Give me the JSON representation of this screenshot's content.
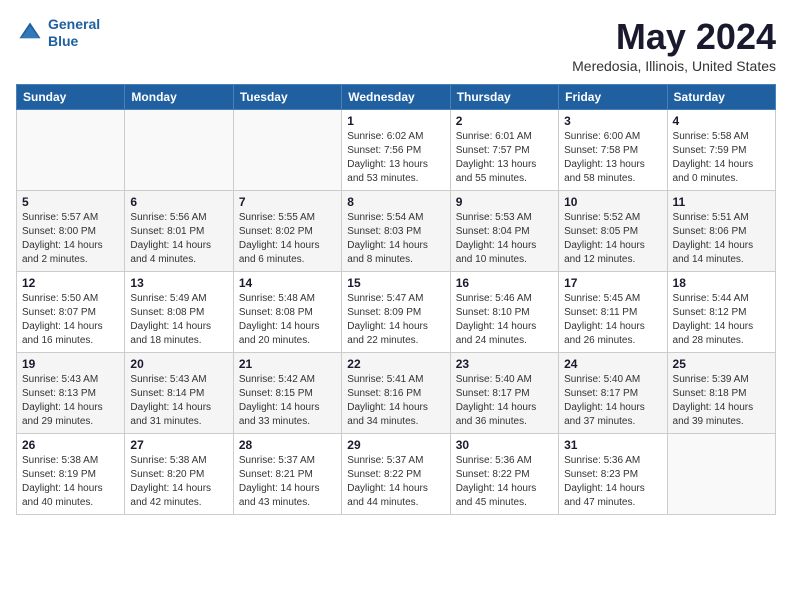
{
  "app": {
    "logo_line1": "General",
    "logo_line2": "Blue"
  },
  "title": "May 2024",
  "subtitle": "Meredosia, Illinois, United States",
  "calendar": {
    "headers": [
      "Sunday",
      "Monday",
      "Tuesday",
      "Wednesday",
      "Thursday",
      "Friday",
      "Saturday"
    ],
    "weeks": [
      [
        {
          "day": "",
          "details": ""
        },
        {
          "day": "",
          "details": ""
        },
        {
          "day": "",
          "details": ""
        },
        {
          "day": "1",
          "details": "Sunrise: 6:02 AM\nSunset: 7:56 PM\nDaylight: 13 hours\nand 53 minutes."
        },
        {
          "day": "2",
          "details": "Sunrise: 6:01 AM\nSunset: 7:57 PM\nDaylight: 13 hours\nand 55 minutes."
        },
        {
          "day": "3",
          "details": "Sunrise: 6:00 AM\nSunset: 7:58 PM\nDaylight: 13 hours\nand 58 minutes."
        },
        {
          "day": "4",
          "details": "Sunrise: 5:58 AM\nSunset: 7:59 PM\nDaylight: 14 hours\nand 0 minutes."
        }
      ],
      [
        {
          "day": "5",
          "details": "Sunrise: 5:57 AM\nSunset: 8:00 PM\nDaylight: 14 hours\nand 2 minutes."
        },
        {
          "day": "6",
          "details": "Sunrise: 5:56 AM\nSunset: 8:01 PM\nDaylight: 14 hours\nand 4 minutes."
        },
        {
          "day": "7",
          "details": "Sunrise: 5:55 AM\nSunset: 8:02 PM\nDaylight: 14 hours\nand 6 minutes."
        },
        {
          "day": "8",
          "details": "Sunrise: 5:54 AM\nSunset: 8:03 PM\nDaylight: 14 hours\nand 8 minutes."
        },
        {
          "day": "9",
          "details": "Sunrise: 5:53 AM\nSunset: 8:04 PM\nDaylight: 14 hours\nand 10 minutes."
        },
        {
          "day": "10",
          "details": "Sunrise: 5:52 AM\nSunset: 8:05 PM\nDaylight: 14 hours\nand 12 minutes."
        },
        {
          "day": "11",
          "details": "Sunrise: 5:51 AM\nSunset: 8:06 PM\nDaylight: 14 hours\nand 14 minutes."
        }
      ],
      [
        {
          "day": "12",
          "details": "Sunrise: 5:50 AM\nSunset: 8:07 PM\nDaylight: 14 hours\nand 16 minutes."
        },
        {
          "day": "13",
          "details": "Sunrise: 5:49 AM\nSunset: 8:08 PM\nDaylight: 14 hours\nand 18 minutes."
        },
        {
          "day": "14",
          "details": "Sunrise: 5:48 AM\nSunset: 8:08 PM\nDaylight: 14 hours\nand 20 minutes."
        },
        {
          "day": "15",
          "details": "Sunrise: 5:47 AM\nSunset: 8:09 PM\nDaylight: 14 hours\nand 22 minutes."
        },
        {
          "day": "16",
          "details": "Sunrise: 5:46 AM\nSunset: 8:10 PM\nDaylight: 14 hours\nand 24 minutes."
        },
        {
          "day": "17",
          "details": "Sunrise: 5:45 AM\nSunset: 8:11 PM\nDaylight: 14 hours\nand 26 minutes."
        },
        {
          "day": "18",
          "details": "Sunrise: 5:44 AM\nSunset: 8:12 PM\nDaylight: 14 hours\nand 28 minutes."
        }
      ],
      [
        {
          "day": "19",
          "details": "Sunrise: 5:43 AM\nSunset: 8:13 PM\nDaylight: 14 hours\nand 29 minutes."
        },
        {
          "day": "20",
          "details": "Sunrise: 5:43 AM\nSunset: 8:14 PM\nDaylight: 14 hours\nand 31 minutes."
        },
        {
          "day": "21",
          "details": "Sunrise: 5:42 AM\nSunset: 8:15 PM\nDaylight: 14 hours\nand 33 minutes."
        },
        {
          "day": "22",
          "details": "Sunrise: 5:41 AM\nSunset: 8:16 PM\nDaylight: 14 hours\nand 34 minutes."
        },
        {
          "day": "23",
          "details": "Sunrise: 5:40 AM\nSunset: 8:17 PM\nDaylight: 14 hours\nand 36 minutes."
        },
        {
          "day": "24",
          "details": "Sunrise: 5:40 AM\nSunset: 8:17 PM\nDaylight: 14 hours\nand 37 minutes."
        },
        {
          "day": "25",
          "details": "Sunrise: 5:39 AM\nSunset: 8:18 PM\nDaylight: 14 hours\nand 39 minutes."
        }
      ],
      [
        {
          "day": "26",
          "details": "Sunrise: 5:38 AM\nSunset: 8:19 PM\nDaylight: 14 hours\nand 40 minutes."
        },
        {
          "day": "27",
          "details": "Sunrise: 5:38 AM\nSunset: 8:20 PM\nDaylight: 14 hours\nand 42 minutes."
        },
        {
          "day": "28",
          "details": "Sunrise: 5:37 AM\nSunset: 8:21 PM\nDaylight: 14 hours\nand 43 minutes."
        },
        {
          "day": "29",
          "details": "Sunrise: 5:37 AM\nSunset: 8:22 PM\nDaylight: 14 hours\nand 44 minutes."
        },
        {
          "day": "30",
          "details": "Sunrise: 5:36 AM\nSunset: 8:22 PM\nDaylight: 14 hours\nand 45 minutes."
        },
        {
          "day": "31",
          "details": "Sunrise: 5:36 AM\nSunset: 8:23 PM\nDaylight: 14 hours\nand 47 minutes."
        },
        {
          "day": "",
          "details": ""
        }
      ]
    ]
  }
}
